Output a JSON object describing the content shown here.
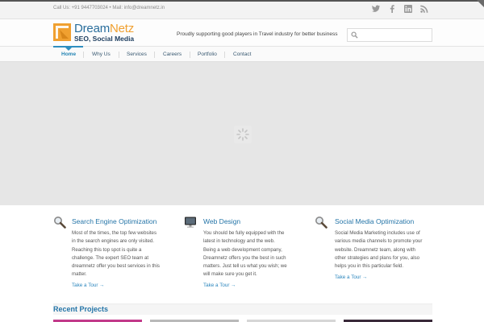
{
  "topbar": {
    "contact": "Call Us: +91 9447703024 • Mail: info@dreamnetz.in",
    "social_icons": [
      "twitter-icon",
      "facebook-icon",
      "linkedin-icon",
      "rss-icon"
    ]
  },
  "header": {
    "logo_name_part1": "Dream",
    "logo_name_part2": "Netz",
    "logo_tagline": "SEO, Social Media",
    "tagline": "Proudly supporting good players in Travel industry for better business",
    "search_placeholder": ""
  },
  "nav": {
    "items": [
      {
        "label": "Home",
        "active": true
      },
      {
        "label": "Why Us",
        "active": false
      },
      {
        "label": "Services",
        "active": false
      },
      {
        "label": "Careers",
        "active": false
      },
      {
        "label": "Portfolio",
        "active": false
      },
      {
        "label": "Contact",
        "active": false
      }
    ]
  },
  "services": [
    {
      "icon": "magnifier-icon",
      "title": "Search Engine Optimization",
      "lines": [
        "Most of the times,   the  top few websites",
        "in the search engines are only visited.",
        "Reaching this top spot is quite a",
        "challenge. The expert SEO team at",
        "dreamnetz offer you best services in this",
        "matter."
      ],
      "link": "Take a Tour →"
    },
    {
      "icon": "monitor-icon",
      "title": "Web Design",
      "lines": [
        "You should be fully equipped with  the",
        " latest  in  technology  and  the  web.",
        "Being a web development company,",
        "Dreamnetz offers you the best in such",
        "matters. Just tell us what you wish; we",
        "will make sure you get it."
      ],
      "link": "Take a Tour →"
    },
    {
      "icon": "magnifier-icon",
      "title": "Social Media Optimization",
      "lines": [
        "Social Media Marketing includes use of",
        "various media channels to promote your",
        "website. Dreamnetz team, along with",
        "other strategies and plans for you, also",
        "helps you in this particular field."
      ],
      "link": "Take a Tour →"
    }
  ],
  "recent": {
    "title": "Recent Projects"
  },
  "colors": {
    "accent": "#2575a8",
    "link": "#2b86bd",
    "nav_active": "#2f8fc0",
    "logo_orange": "#f0a030"
  }
}
